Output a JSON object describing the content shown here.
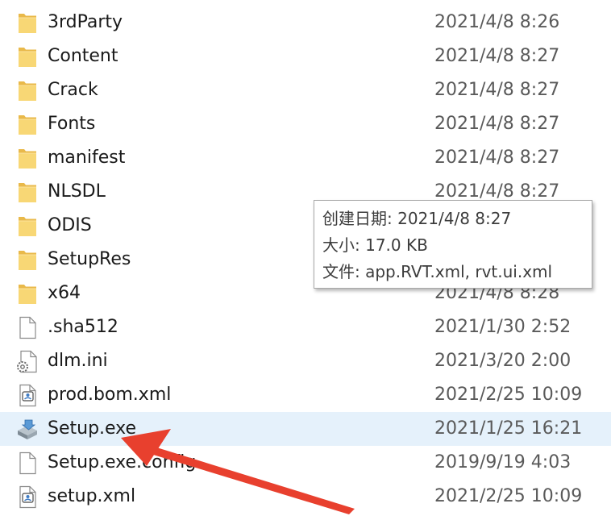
{
  "files": [
    {
      "name": "3rdParty",
      "date": "2021/4/8 8:26",
      "icon": "folder-icon"
    },
    {
      "name": "Content",
      "date": "2021/4/8 8:27",
      "icon": "folder-icon"
    },
    {
      "name": "Crack",
      "date": "2021/4/8 8:27",
      "icon": "folder-icon"
    },
    {
      "name": "Fonts",
      "date": "2021/4/8 8:27",
      "icon": "folder-icon"
    },
    {
      "name": "manifest",
      "date": "2021/4/8 8:27",
      "icon": "folder-icon"
    },
    {
      "name": "NLSDL",
      "date": "2021/4/8 8:27",
      "icon": "folder-icon"
    },
    {
      "name": "ODIS",
      "date": "2021/4/8 8:27",
      "icon": "folder-icon"
    },
    {
      "name": "SetupRes",
      "date": "2021/4/8 8:27",
      "icon": "folder-icon"
    },
    {
      "name": "x64",
      "date": "2021/4/8 8:28",
      "icon": "folder-icon"
    },
    {
      "name": ".sha512",
      "date": "2021/1/30 2:52",
      "icon": "blank-file-icon"
    },
    {
      "name": "dlm.ini",
      "date": "2021/3/20 2:00",
      "icon": "settings-file-icon"
    },
    {
      "name": "prod.bom.xml",
      "date": "2021/2/25 10:09",
      "icon": "xml-file-icon"
    },
    {
      "name": "Setup.exe",
      "date": "2021/1/25 16:21",
      "icon": "installer-icon",
      "selected": true
    },
    {
      "name": "Setup.exe.config",
      "date": "2019/9/19 4:03",
      "icon": "blank-file-icon"
    },
    {
      "name": "setup.xml",
      "date": "2021/2/25 10:09",
      "icon": "xml-file-icon"
    }
  ],
  "tooltip": {
    "created": "创建日期: 2021/4/8 8:27",
    "size": "大小: 17.0 KB",
    "files": "文件: app.RVT.xml, rvt.ui.xml"
  },
  "colors": {
    "folder": "#f8d775",
    "selection": "#e5f1fb",
    "arrow": "#e8402e"
  },
  "annotation": {
    "icon": "red-arrow-icon",
    "target": "Setup.exe"
  }
}
